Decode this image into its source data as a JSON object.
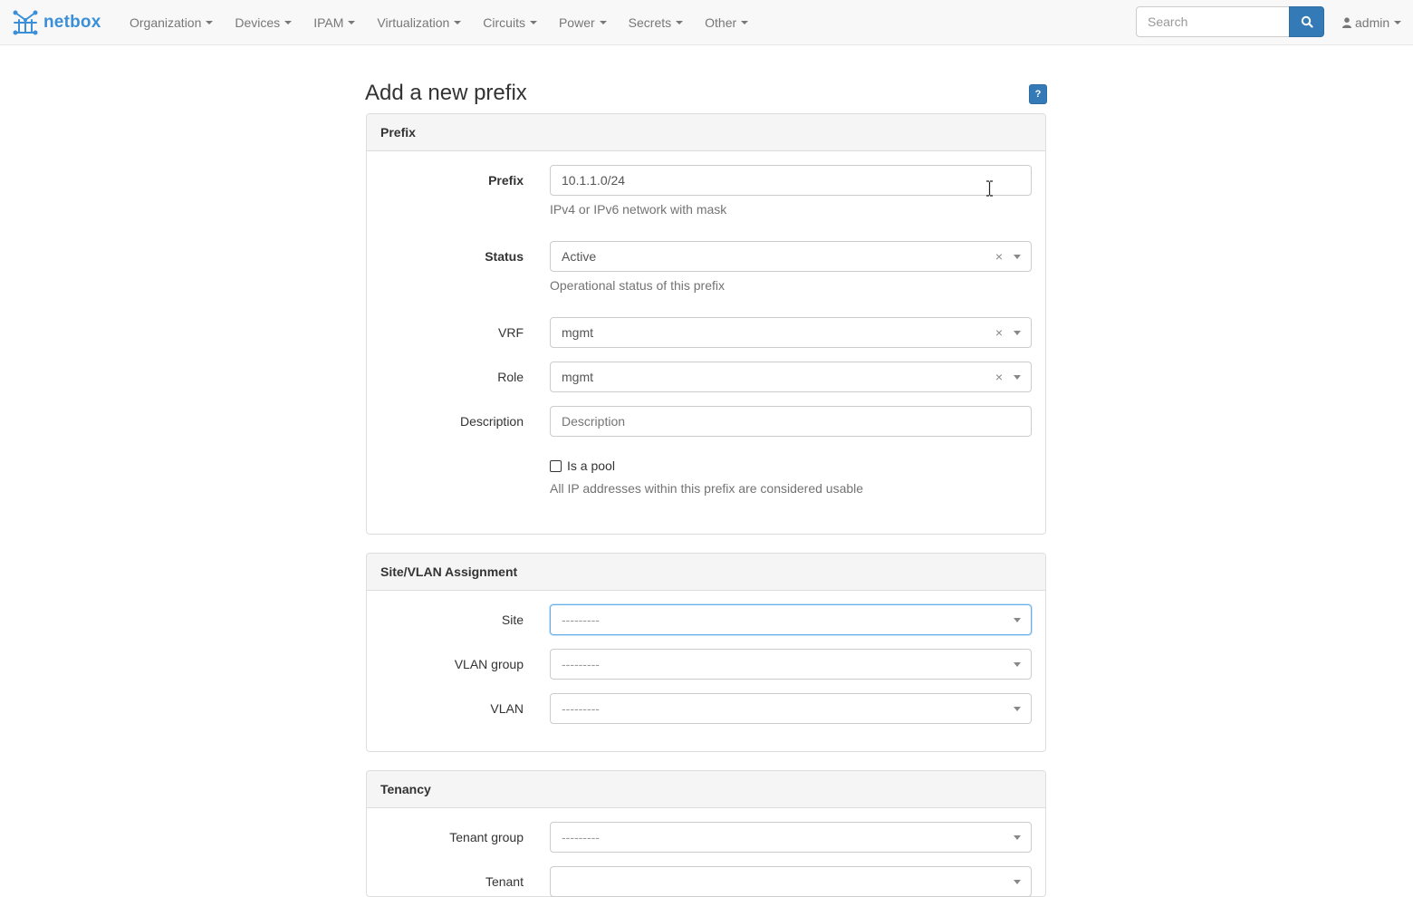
{
  "brand": {
    "name": "netbox"
  },
  "nav": {
    "items": [
      {
        "label": "Organization"
      },
      {
        "label": "Devices"
      },
      {
        "label": "IPAM"
      },
      {
        "label": "Virtualization"
      },
      {
        "label": "Circuits"
      },
      {
        "label": "Power"
      },
      {
        "label": "Secrets"
      },
      {
        "label": "Other"
      }
    ],
    "search_placeholder": "Search",
    "search_icon": "search-icon",
    "user": "admin",
    "user_icon": "user-icon"
  },
  "page": {
    "title": "Add a new prefix",
    "help_label": "?"
  },
  "prefix_panel": {
    "heading": "Prefix",
    "prefix_label": "Prefix",
    "prefix_value": "10.1.1.0/24",
    "prefix_help": "IPv4 or IPv6 network with mask",
    "status_label": "Status",
    "status_value": "Active",
    "status_help": "Operational status of this prefix",
    "vrf_label": "VRF",
    "vrf_value": "mgmt",
    "role_label": "Role",
    "role_value": "mgmt",
    "description_label": "Description",
    "description_placeholder": "Description",
    "description_value": "",
    "is_pool_label": "Is a pool",
    "is_pool_checked": false,
    "is_pool_help": "All IP addresses within this prefix are considered usable",
    "clear_symbol": "×"
  },
  "site_panel": {
    "heading": "Site/VLAN Assignment",
    "site_label": "Site",
    "site_value": "---------",
    "vlan_group_label": "VLAN group",
    "vlan_group_value": "---------",
    "vlan_label": "VLAN",
    "vlan_value": "---------"
  },
  "tenancy_panel": {
    "heading": "Tenancy",
    "tenant_group_label": "Tenant group",
    "tenant_group_value": "---------",
    "tenant_label": "Tenant"
  },
  "colors": {
    "accent": "#337ab7",
    "brand": "#3a8fd8",
    "navbar_bg": "#f8f8f8",
    "panel_heading_bg": "#f5f5f5"
  }
}
